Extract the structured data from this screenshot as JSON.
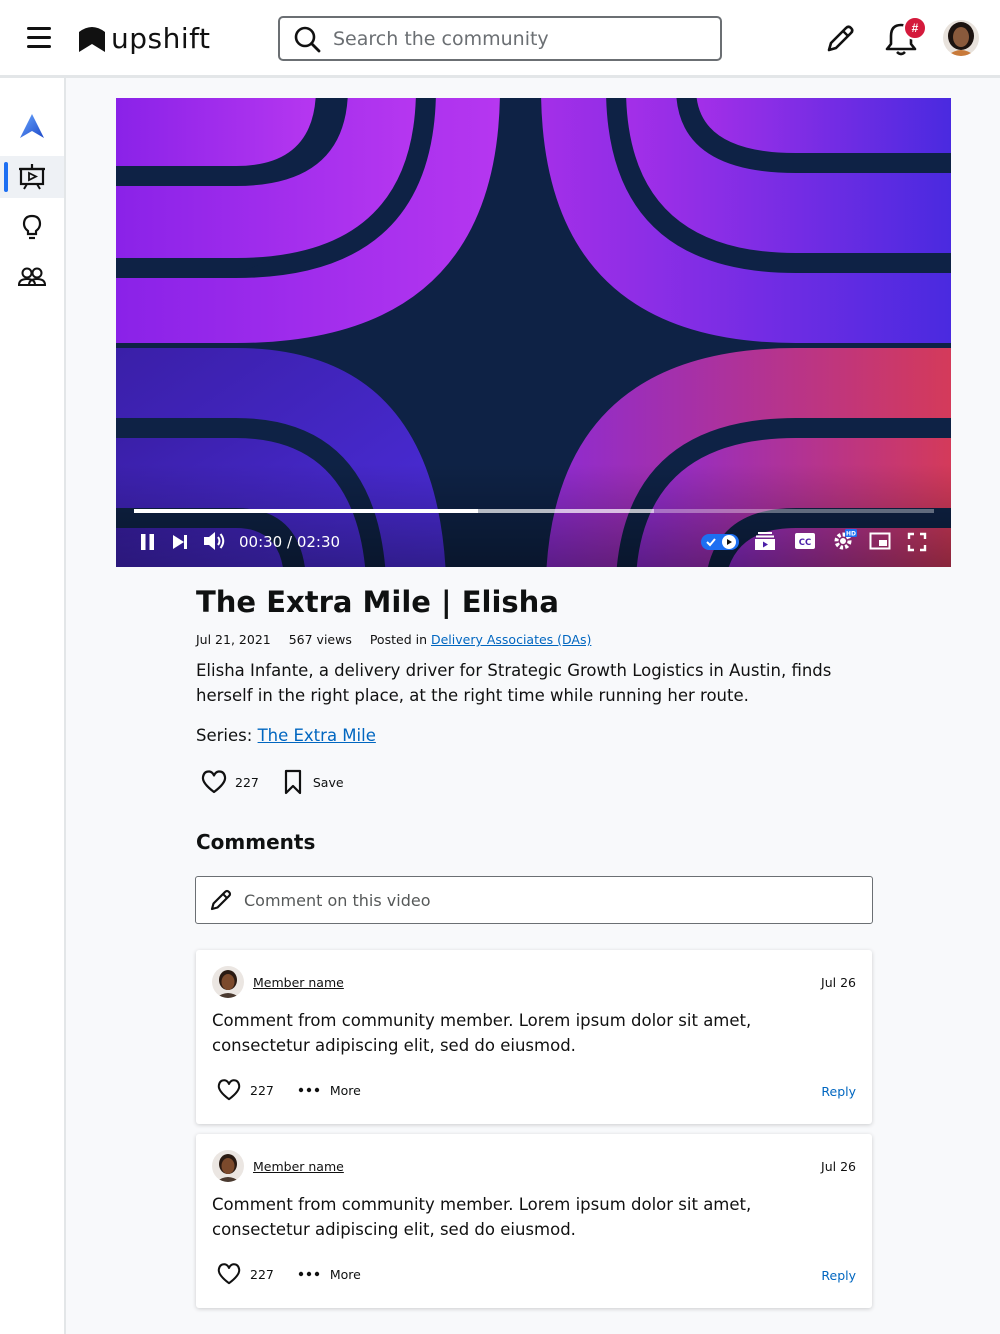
{
  "header": {
    "brand": "upshift",
    "search_placeholder": "Search the community",
    "notification_badge": "#"
  },
  "video": {
    "current_time": "00:30",
    "duration": "02:30",
    "progress_fraction": 0.43,
    "buffered_fraction": 0.65
  },
  "post": {
    "title": "The Extra Mile | Elisha",
    "date": "Jul 21, 2021",
    "views": "567 views",
    "posted_in_label": "Posted in",
    "posted_in_link": "Delivery Associates (DAs)",
    "description": "Elisha Infante, a delivery driver for Strategic Growth Logistics in Austin, finds herself in the right place, at the right time while running her route.",
    "series_label": "Series:",
    "series_link": "The Extra Mile",
    "likes": "227",
    "save_label": "Save"
  },
  "comments": {
    "heading": "Comments",
    "input_placeholder": "Comment on this video",
    "items": [
      {
        "member": "Member name",
        "date": "Jul 26",
        "text": "Comment from community member. Lorem ipsum dolor sit amet, consectetur adipiscing elit, sed do eiusmod.",
        "likes": "227",
        "more_label": "More",
        "reply_label": "Reply"
      },
      {
        "member": "Member name",
        "date": "Jul 26",
        "text": "Comment from community member. Lorem ipsum dolor sit amet, consectetur adipiscing elit, sed do eiusmod.",
        "likes": "227",
        "more_label": "More",
        "reply_label": "Reply"
      }
    ]
  },
  "colors": {
    "link": "#0066c0",
    "accent": "#1d6ff2",
    "badge": "#d41a3c"
  }
}
